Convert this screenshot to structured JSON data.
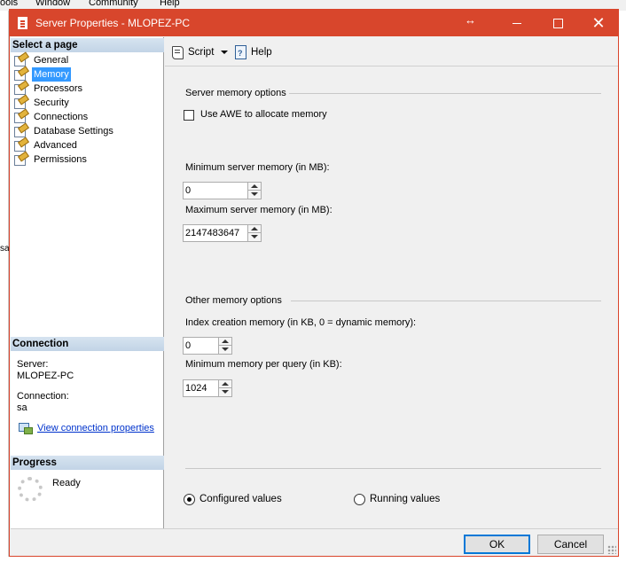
{
  "background_app": {
    "menu": [
      "ools",
      "Window",
      "Community",
      "Help"
    ],
    "side_text": "sa"
  },
  "window": {
    "title": "Server Properties - MLOPEZ-PC",
    "controls": {
      "minimize": "–",
      "maximize": "□",
      "close": "✕"
    }
  },
  "sidebar": {
    "select_header": "Select a page",
    "pages": [
      {
        "label": "General",
        "icon": "page-wrench-icon"
      },
      {
        "label": "Memory",
        "icon": "page-wrench-icon",
        "selected": true
      },
      {
        "label": "Processors",
        "icon": "page-wrench-icon"
      },
      {
        "label": "Security",
        "icon": "page-wrench-icon"
      },
      {
        "label": "Connections",
        "icon": "page-wrench-icon"
      },
      {
        "label": "Database Settings",
        "icon": "page-wrench-icon"
      },
      {
        "label": "Advanced",
        "icon": "page-wrench-icon"
      },
      {
        "label": "Permissions",
        "icon": "page-wrench-icon"
      }
    ],
    "connection_header": "Connection",
    "server_label": "Server:",
    "server_value": "MLOPEZ-PC",
    "connection_label": "Connection:",
    "connection_value": "sa",
    "view_link": "View connection properties",
    "progress_header": "Progress",
    "progress_status": "Ready"
  },
  "toolbar": {
    "script_label": "Script",
    "help_label": "Help"
  },
  "memory": {
    "server_group_title": "Server memory options",
    "awe_label": "Use AWE to allocate memory",
    "awe_checked": false,
    "min_label": "Minimum server memory (in MB):",
    "min_value": "0",
    "max_label": "Maximum server memory (in MB):",
    "max_value": "2147483647",
    "other_group_title": "Other memory options",
    "index_label": "Index creation memory (in KB, 0 = dynamic memory):",
    "index_value": "0",
    "query_label": "Minimum memory per query (in KB):",
    "query_value": "1024",
    "configured_label": "Configured values",
    "running_label": "Running values",
    "selected_mode": "configured"
  },
  "footer": {
    "ok_label": "OK",
    "cancel_label": "Cancel"
  }
}
